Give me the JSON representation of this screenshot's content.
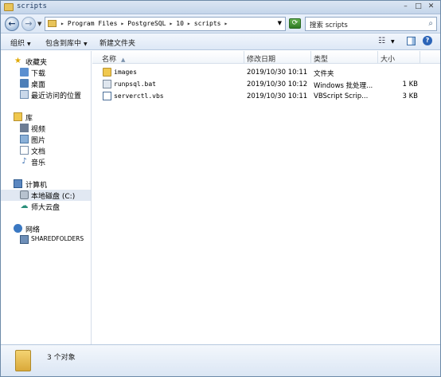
{
  "window": {
    "title": "scripts"
  },
  "title_buttons": [
    "–",
    "□",
    "✕"
  ],
  "address": {
    "crumbs": [
      "Program Files",
      "PostgreSQL",
      "10",
      "scripts"
    ],
    "search_placeholder": "搜索 scripts"
  },
  "toolbar": {
    "organize": "组织",
    "include_in_library": "包含到库中",
    "new_folder": "新建文件夹"
  },
  "nav": {
    "favorites": "收藏夹",
    "downloads": "下载",
    "desktop": "桌面",
    "recent": "最近访问的位置",
    "libraries": "库",
    "videos": "视频",
    "pictures": "图片",
    "documents": "文档",
    "music": "音乐",
    "computer": "计算机",
    "local_disk": "本地磁盘 (C:)",
    "cloud": "师大云盘",
    "network": "网络",
    "sharedfolders": "SHAREDFOLDERS"
  },
  "columns": {
    "name": "名称",
    "date": "修改日期",
    "type": "类型",
    "size": "大小"
  },
  "files": [
    {
      "name": "images",
      "date": "2019/10/30 10:11",
      "type": "文件夹",
      "size": ""
    },
    {
      "name": "runpsql.bat",
      "date": "2019/10/30 10:12",
      "type": "Windows 批处理...",
      "size": "1 KB"
    },
    {
      "name": "serverctl.vbs",
      "date": "2019/10/30 10:11",
      "type": "VBScript Scrip...",
      "size": "3 KB"
    }
  ],
  "status": {
    "count_text": "3 个对象"
  }
}
